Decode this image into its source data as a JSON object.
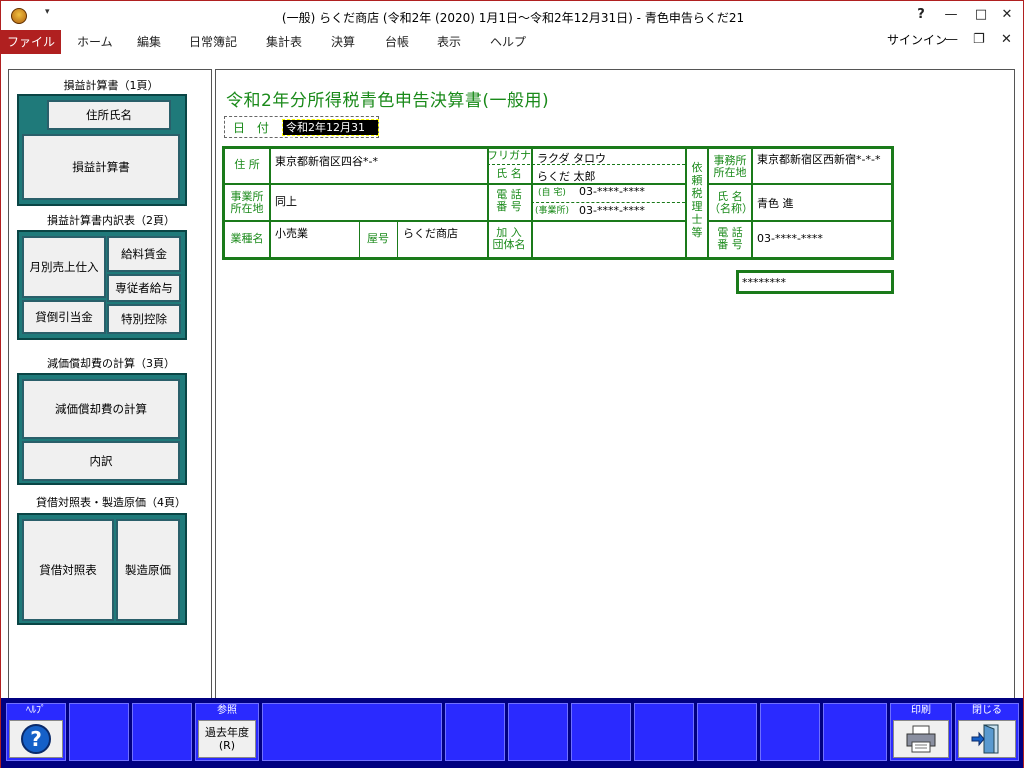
{
  "window": {
    "title": "(一般) らくだ商店 (令和2年 (2020) 1月1日～令和2年12月31日) - 青色申告らくだ21",
    "help_btn": "?",
    "qat_symbol": "▾"
  },
  "menu": {
    "file": "ファイル",
    "items": [
      "ホーム",
      "編集",
      "日常簿記",
      "集計表",
      "決算",
      "台帳",
      "表示",
      "ヘルプ"
    ],
    "signin": "サインイン"
  },
  "sidebar": {
    "section1": "損益計算書（1頁）",
    "btn_address": "住所氏名",
    "btn_pl": "損益計算書",
    "section2": "損益計算書内訳表（2頁）",
    "btn_monthly": "月別売上仕入",
    "btn_salary": "給料賃金",
    "btn_family": "専従者給与",
    "btn_baddebt": "貸倒引当金",
    "btn_special": "特別控除",
    "section3": "減価償却費の計算（3頁）",
    "btn_depr": "減価償却費の計算",
    "btn_detail": "内訳",
    "section4": "貸借対照表・製造原価（4頁）",
    "btn_bs": "貸借対照表",
    "btn_mfg": "製造原価"
  },
  "form": {
    "title": "令和2年分所得税青色申告決算書(一般用)",
    "date_label": "日 付",
    "date_value": "令和2年12月31日",
    "address_label": "住 所",
    "address_value": "東京都新宿区四谷*-*",
    "office_label": "事業所所在地",
    "office_value": "同上",
    "industry_label": "業種名",
    "industry_value": "小売業",
    "shop_label": "屋号",
    "shop_value": "らくだ商店",
    "furigana_label": "フリガナ",
    "furigana_value": "ラクダ タロウ",
    "name_label": "氏 名",
    "name_value": "らくだ 太郎",
    "phone_label": "電 話 番 号",
    "home_label": "(自 宅)",
    "home_value": "03-****-****",
    "biz_label": "(事業所)",
    "biz_value": "03-****-****",
    "group_label": "加 入 団体名",
    "tax_agent_label": "依頼税理士等",
    "agent_office_label": "事務所所在地",
    "agent_office_value": "東京都新宿区西新宿*-*-*",
    "agent_name_label": "氏 名（名称）",
    "agent_name_value": "青色 進",
    "agent_phone_label": "電 話 番 号",
    "agent_phone_value": "03-****-****",
    "agent_reg_value": "********"
  },
  "fkeys": {
    "help_top": "ﾍﾙﾌﾟ",
    "ref_top": "参照",
    "ref_body": "過去年度\n(R)",
    "print_top": "印刷",
    "close_top": "閉じる"
  }
}
